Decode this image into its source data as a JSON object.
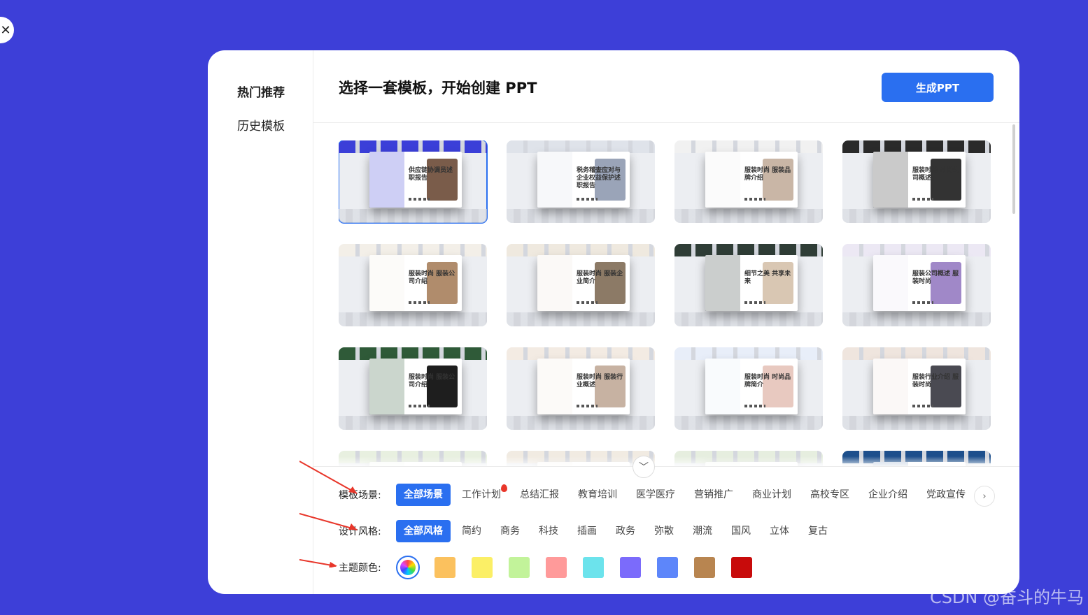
{
  "sidebar": {
    "items": [
      {
        "label": "热门推荐",
        "active": true
      },
      {
        "label": "历史模板",
        "active": false
      }
    ]
  },
  "header": {
    "title": "选择一套模板，开始创建 PPT",
    "generate_label": "生成PPT"
  },
  "templates": [
    {
      "title": "供应链协调员述职报告",
      "accent": "#3b3fd8",
      "selected": true
    },
    {
      "title": "税务稽查应对与企业权益保护述职报告",
      "accent": "#dfe3ea",
      "selected": false
    },
    {
      "title": "服装时尚 服装品牌介绍",
      "accent": "#f1f1f1",
      "selected": false
    },
    {
      "title": "服装时尚 时尚公司概述",
      "accent": "#2a2a2a",
      "selected": false
    },
    {
      "title": "服装时尚 服装公司介绍",
      "accent": "#f3efe8",
      "selected": false
    },
    {
      "title": "服装时尚 服装企业简介",
      "accent": "#efe9df",
      "selected": false
    },
    {
      "title": "细节之美 共享未来",
      "accent": "#2f3d36",
      "selected": false
    },
    {
      "title": "服装公司概述 服装时尚",
      "accent": "#ece8f4",
      "selected": false
    },
    {
      "title": "服装时尚 服装公司介绍",
      "accent": "#2f5a38",
      "selected": false
    },
    {
      "title": "服装时尚 服装行业概述",
      "accent": "#f3ebe3",
      "selected": false
    },
    {
      "title": "服装时尚 时尚品牌简介",
      "accent": "#e8eef9",
      "selected": false
    },
    {
      "title": "服装行业介绍 服装时尚",
      "accent": "#efe5de",
      "selected": false
    },
    {
      "title": "",
      "accent": "#e8f0e0",
      "selected": false
    },
    {
      "title": "",
      "accent": "#f1ebe2",
      "selected": false
    },
    {
      "title": "",
      "accent": "#e6eedf",
      "selected": false
    },
    {
      "title": "",
      "accent": "#1d4f8c",
      "selected": false
    }
  ],
  "filters": {
    "scene": {
      "label": "模板场景:",
      "options": [
        "全部场景",
        "工作计划",
        "总结汇报",
        "教育培训",
        "医学医疗",
        "营销推广",
        "商业计划",
        "高校专区",
        "企业介绍",
        "党政宣传"
      ],
      "active": 0,
      "hot_index": 1
    },
    "style": {
      "label": "设计风格:",
      "options": [
        "全部风格",
        "简约",
        "商务",
        "科技",
        "插画",
        "政务",
        "弥散",
        "潮流",
        "国风",
        "立体",
        "复古"
      ],
      "active": 0
    },
    "color": {
      "label": "主题颜色:",
      "swatches": [
        "#fbc15e",
        "#fbef66",
        "#c2f39a",
        "#ff9a9a",
        "#6ce3ec",
        "#7b6bfb",
        "#5d86fa",
        "#b88550",
        "#c80b0b"
      ]
    }
  },
  "watermark": "CSDN @奋斗的牛马"
}
